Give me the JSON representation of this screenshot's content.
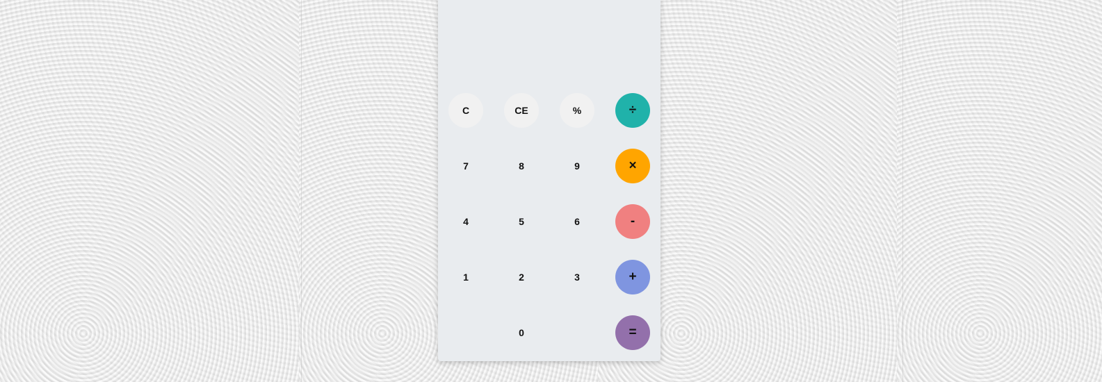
{
  "display": {
    "value": ""
  },
  "keys": {
    "clear": "C",
    "clear_entry": "CE",
    "percent": "%",
    "divide": "÷",
    "seven": "7",
    "eight": "8",
    "nine": "9",
    "multiply": "×",
    "four": "4",
    "five": "5",
    "six": "6",
    "minus": "-",
    "one": "1",
    "two": "2",
    "three": "3",
    "plus": "+",
    "zero": "0",
    "equals": "="
  },
  "colors": {
    "divide": "#20b2aa",
    "multiply": "#ffa500",
    "minus": "#f08080",
    "plus": "#7f95e0",
    "equals": "#9370ab",
    "function_key": "#f1f1f1",
    "panel": "#e9ecef"
  }
}
